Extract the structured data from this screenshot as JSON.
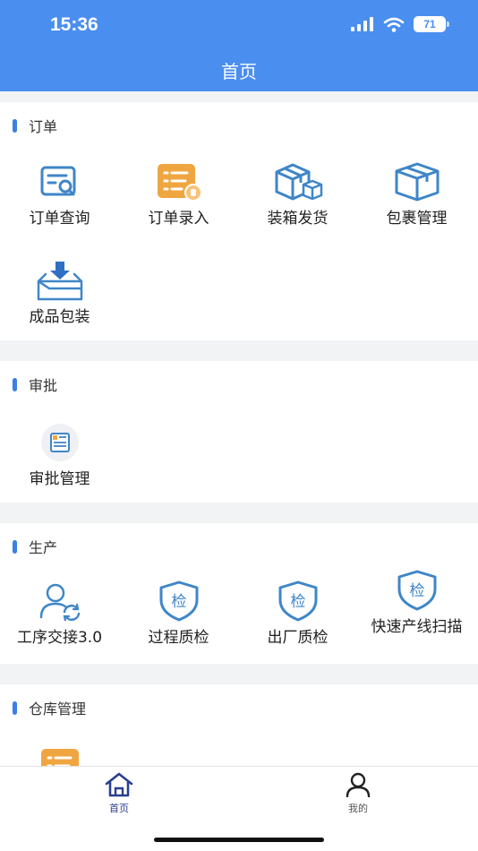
{
  "status": {
    "time": "15:36",
    "battery": "71"
  },
  "header": {
    "title": "首页"
  },
  "sections": {
    "order": {
      "title": "订单",
      "items": [
        "订单查询",
        "订单录入",
        "装箱发货",
        "包裹管理",
        "成品包装"
      ]
    },
    "approval": {
      "title": "审批",
      "items": [
        "审批管理"
      ]
    },
    "production": {
      "title": "生产",
      "items": [
        "工序交接3.0",
        "过程质检",
        "出厂质检",
        "快速产线扫描"
      ],
      "shield_text": "检"
    },
    "warehouse": {
      "title": "仓库管理"
    }
  },
  "tabbar": {
    "home": "首页",
    "mine": "我的"
  },
  "colors": {
    "accent": "#4a8ef0",
    "icon_blue": "#3f86c8",
    "icon_orange": "#f0a640"
  },
  "icons": [
    "search-doc-icon",
    "form-entry-icon",
    "boxes-icon",
    "package-icon",
    "box-download-icon",
    "approval-doc-icon",
    "user-sync-icon",
    "shield-check-icon",
    "home-icon",
    "person-icon"
  ]
}
